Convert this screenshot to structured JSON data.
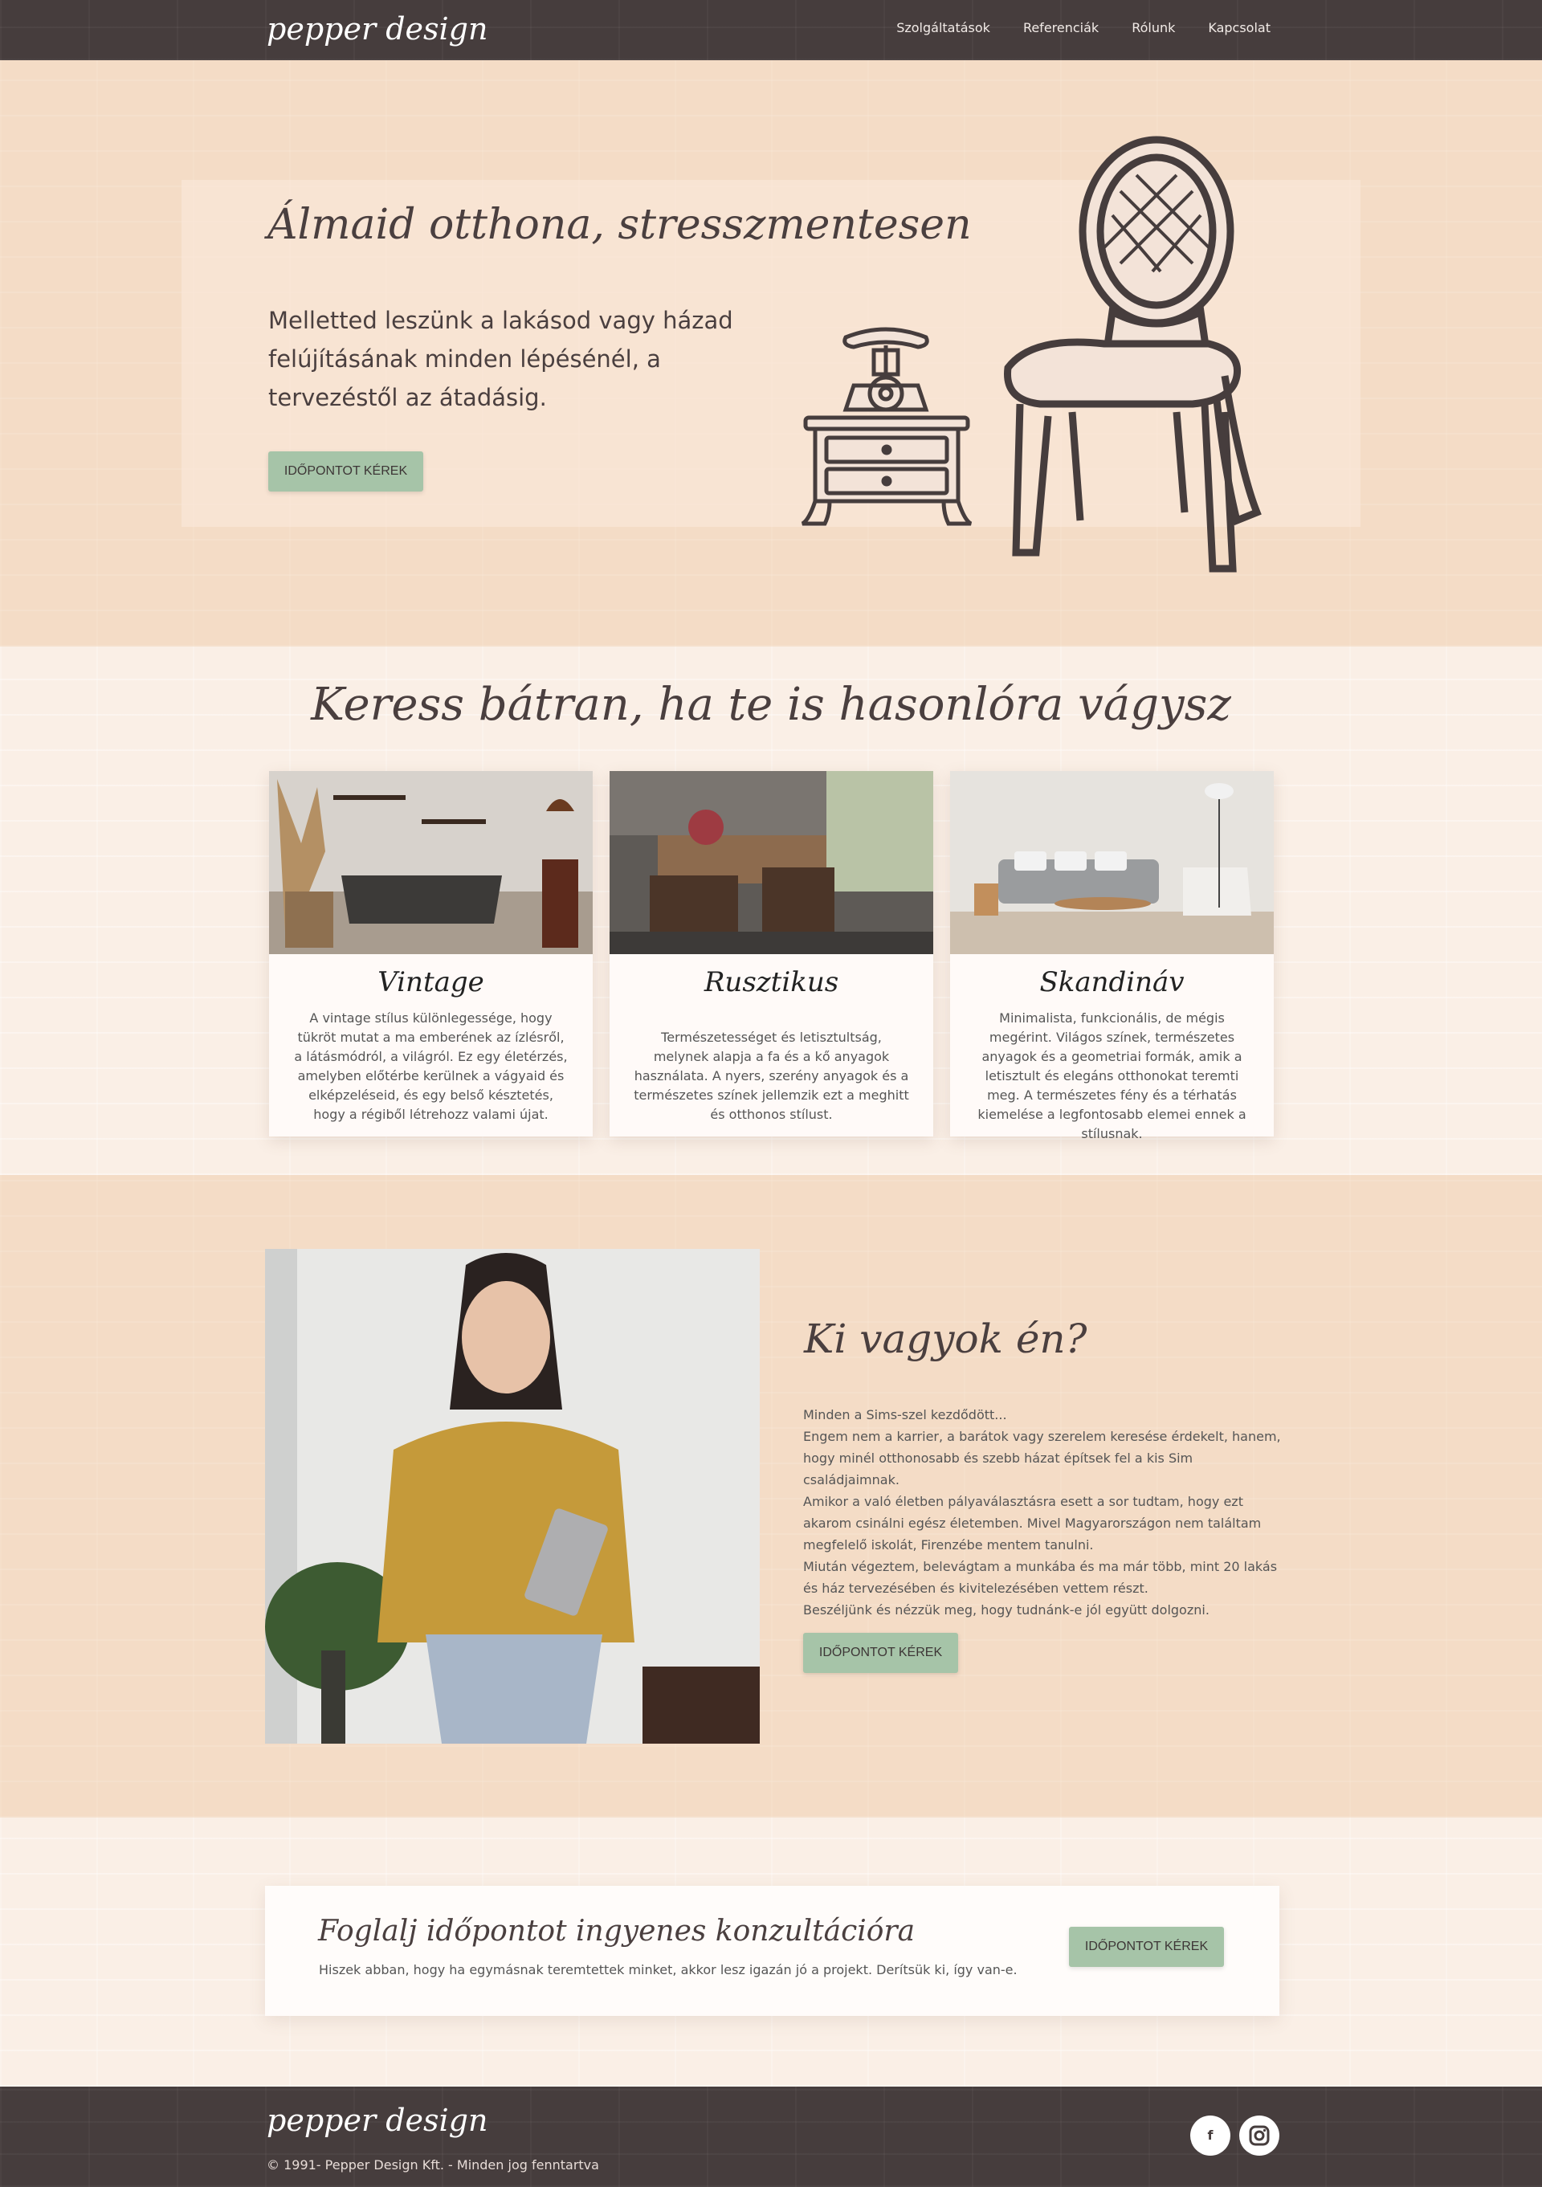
{
  "nav": {
    "logo": "pepper design",
    "links": [
      "Szolgáltatások",
      "Referenciák",
      "Rólunk",
      "Kapcsolat"
    ]
  },
  "hero": {
    "title": "Álmaid otthona, stresszmentesen",
    "text": "Melletted leszünk a lakásod vagy házad felújításának minden lépésénél, a tervezéstől az átadásig.",
    "button": "Időpontot kérek"
  },
  "styles": {
    "title": "Keress bátran, ha te is hasonlóra vágysz",
    "cards": [
      {
        "title": "Vintage",
        "text": "A vintage stílus különlegessége, hogy tükröt mutat a ma emberének az ízlésről, a látásmódról, a világról. Ez egy életérzés, amelyben előtérbe kerülnek a vágyaid és elképzeléseid, és egy belső késztetés, hogy a régiből létrehozz valami újat."
      },
      {
        "title": "Rusztikus",
        "text": "Természetességet és letisztultság, melynek alapja a fa és a kő anyagok használata. A nyers, szerény anyagok és a természetes színek jellemzik ezt a meghitt és otthonos stílust."
      },
      {
        "title": "Skandináv",
        "text": "Minimalista, funkcionális, de mégis megérint. Világos színek, természetes anyagok és a geometriai formák, amik a letisztult és elegáns otthonokat teremti meg. A természetes fény és a térhatás kiemelése a legfontosabb elemei ennek a stílusnak."
      }
    ]
  },
  "about": {
    "title": "Ki vagyok én?",
    "lines": [
      "Minden a Sims-szel kezdődött...",
      "Engem nem a karrier, a barátok vagy szerelem keresése érdekelt, hanem, hogy minél otthonosabb és szebb házat építsek fel a kis Sim családjaimnak.",
      "Amikor a való életben pályaválasztásra esett a sor tudtam, hogy ezt akarom csinálni egész életemben. Mivel Magyarországon nem találtam megfelelő iskolát,  Firenzébe mentem tanulni.",
      "Miután végeztem, belevágtam a munkába és ma már több, mint 20 lakás és ház tervezésében és kivitelezésében vettem részt.",
      "Beszéljünk és nézzük meg, hogy tudnánk-e jól együtt dolgozni."
    ],
    "button": "Időpontot kérek"
  },
  "cta": {
    "title": "Foglalj időpontot ingyenes konzultációra",
    "text": "Hiszek abban, hogy ha egymásnak teremtettek minket, akkor lesz igazán jó a projekt. Derítsük ki, így van-e.",
    "button": "Időpontot kérek"
  },
  "footer": {
    "logo": "pepper design",
    "copyright": "© 1991- Pepper Design Kft. - Minden jog fenntartva",
    "social": [
      "facebook-icon",
      "instagram-icon"
    ]
  },
  "colors": {
    "dark": "#463d3d",
    "peach": "#f4dcc6",
    "cream": "#faefe6",
    "button": "#a6c4a8"
  }
}
